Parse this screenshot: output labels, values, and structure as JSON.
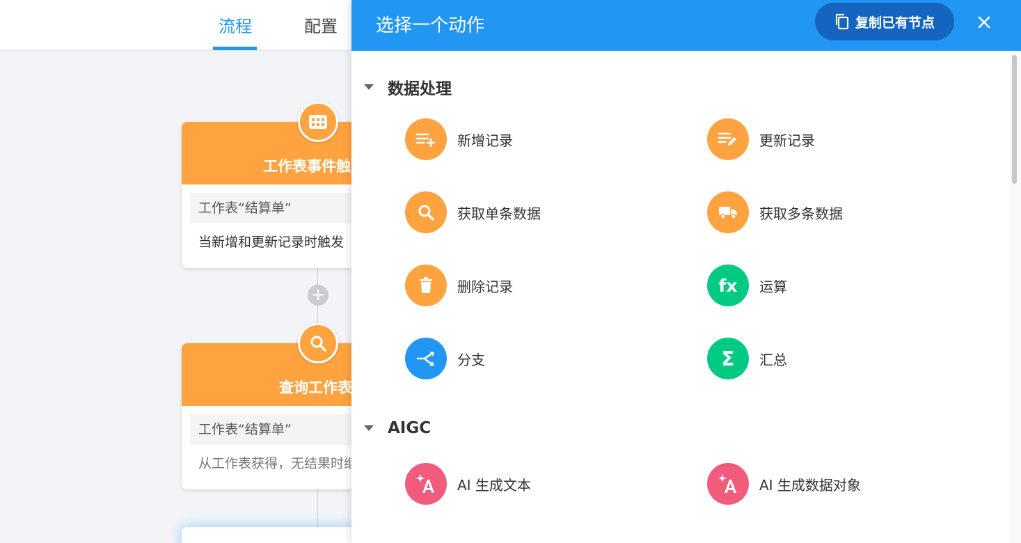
{
  "topbar": {
    "tabs": [
      {
        "label": "流程"
      },
      {
        "label": "配置"
      }
    ]
  },
  "canvas": {
    "nodes": [
      {
        "title": "工作表事件触发",
        "sub": "工作表“结算单”",
        "desc": "当新增和更新记录时触发",
        "icon": "table-icon"
      },
      {
        "title": "查询工作表",
        "sub": "工作表“结算单”",
        "desc": "从工作表获得，无结果时继续执行",
        "icon": "search-icon"
      }
    ],
    "add_label": "+"
  },
  "panel": {
    "title": "选择一个动作",
    "copy_label": "复制已有节点",
    "sections": [
      {
        "title": "数据处理",
        "actions": [
          {
            "label": "新增记录",
            "icon": "add-record-icon",
            "color": "#ffa340"
          },
          {
            "label": "更新记录",
            "icon": "edit-record-icon",
            "color": "#ffa340"
          },
          {
            "label": "获取单条数据",
            "icon": "search-icon",
            "color": "#ffa340"
          },
          {
            "label": "获取多条数据",
            "icon": "truck-icon",
            "color": "#ffa340"
          },
          {
            "label": "删除记录",
            "icon": "trash-icon",
            "color": "#ffa340"
          },
          {
            "label": "运算",
            "icon": "fx-icon",
            "color": "#01ca83"
          },
          {
            "label": "分支",
            "icon": "branch-icon",
            "color": "#2196f3"
          },
          {
            "label": "汇总",
            "icon": "sigma-icon",
            "color": "#01ca83"
          }
        ]
      },
      {
        "title": "AIGC",
        "actions": [
          {
            "label": "AI 生成文本",
            "icon": "ai-text-icon",
            "color": "#f15b7c"
          },
          {
            "label": "AI 生成数据对象",
            "icon": "ai-data-icon",
            "color": "#f15b7c"
          }
        ]
      }
    ]
  }
}
